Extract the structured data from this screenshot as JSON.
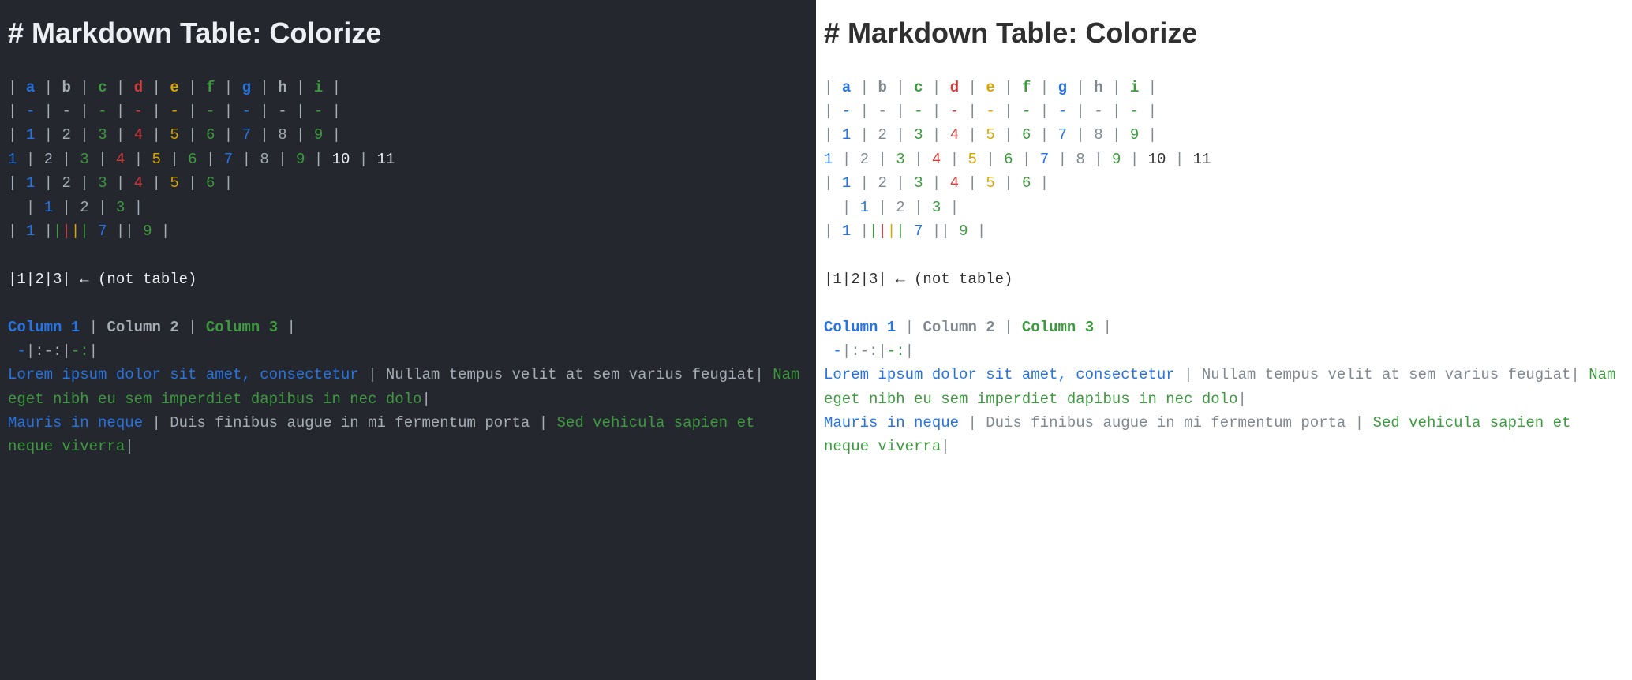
{
  "title": "# Markdown Table: Colorize",
  "pipe": "|",
  "sp": " ",
  "hdr": {
    "a": "a",
    "b": "b",
    "c": "c",
    "d": "d",
    "e": "e",
    "f": "f",
    "g": "g",
    "h": "h",
    "i": "i"
  },
  "dash": "-",
  "row3": {
    "c1": "1",
    "c2": "2",
    "c3": "3",
    "c4": "4",
    "c5": "5",
    "c6": "6",
    "c7": "7",
    "c8": "8",
    "c9": "9"
  },
  "row4": {
    "c1": "1",
    "c2": "2",
    "c3": "3",
    "c4": "4",
    "c5": "5",
    "c6": "6",
    "c7": "7",
    "c8": "8",
    "c9": "9",
    "c10": "10",
    "c11": "11"
  },
  "row5": {
    "c1": "1",
    "c2": "2",
    "c3": "3",
    "c4": "4",
    "c5": "5",
    "c6": "6"
  },
  "row6": {
    "c1": "1",
    "c2": "2",
    "c3": "3"
  },
  "row7": {
    "c1": "1",
    "c7": "7",
    "c9": "9"
  },
  "not_table": "|1|2|3| ← (not table)",
  "cols": {
    "c1": "Column 1",
    "c2": "Column 2",
    "c3": "Column 3"
  },
  "align_row": " -|:-:|-:|",
  "para_r1_c1": "Lorem ipsum dolor sit amet, consectetur",
  "para_r1_c2": "Nullam tempus velit at sem varius feugiat",
  "para_r1_c3": "Nam eget nibh eu sem imperdiet dapibus in nec dolo",
  "para_r2_c1": "Mauris in neque",
  "para_r2_c2": "Duis finibus augue in mi fermentum porta",
  "para_r2_c3": "Sed vehicula sapien et neque viverra"
}
